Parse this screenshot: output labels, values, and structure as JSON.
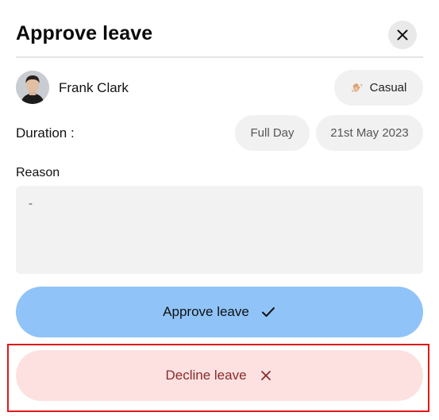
{
  "dialog": {
    "title": "Approve leave",
    "close_icon": "close-icon"
  },
  "employee": {
    "name": "Frank Clark",
    "leave_type": "Casual",
    "leave_type_icon": "waving-hand-icon"
  },
  "duration": {
    "label": "Duration :",
    "period": "Full Day",
    "date": "21st May 2023"
  },
  "reason": {
    "label": "Reason",
    "value": "-"
  },
  "actions": {
    "approve_label": "Approve leave",
    "approve_icon": "check-icon",
    "decline_label": "Decline leave",
    "decline_icon": "x-icon"
  },
  "colors": {
    "approve_bg": "#90c4f8",
    "decline_bg": "#fde1e1",
    "decline_text": "#8a2a2a",
    "highlight": "#e11919"
  }
}
